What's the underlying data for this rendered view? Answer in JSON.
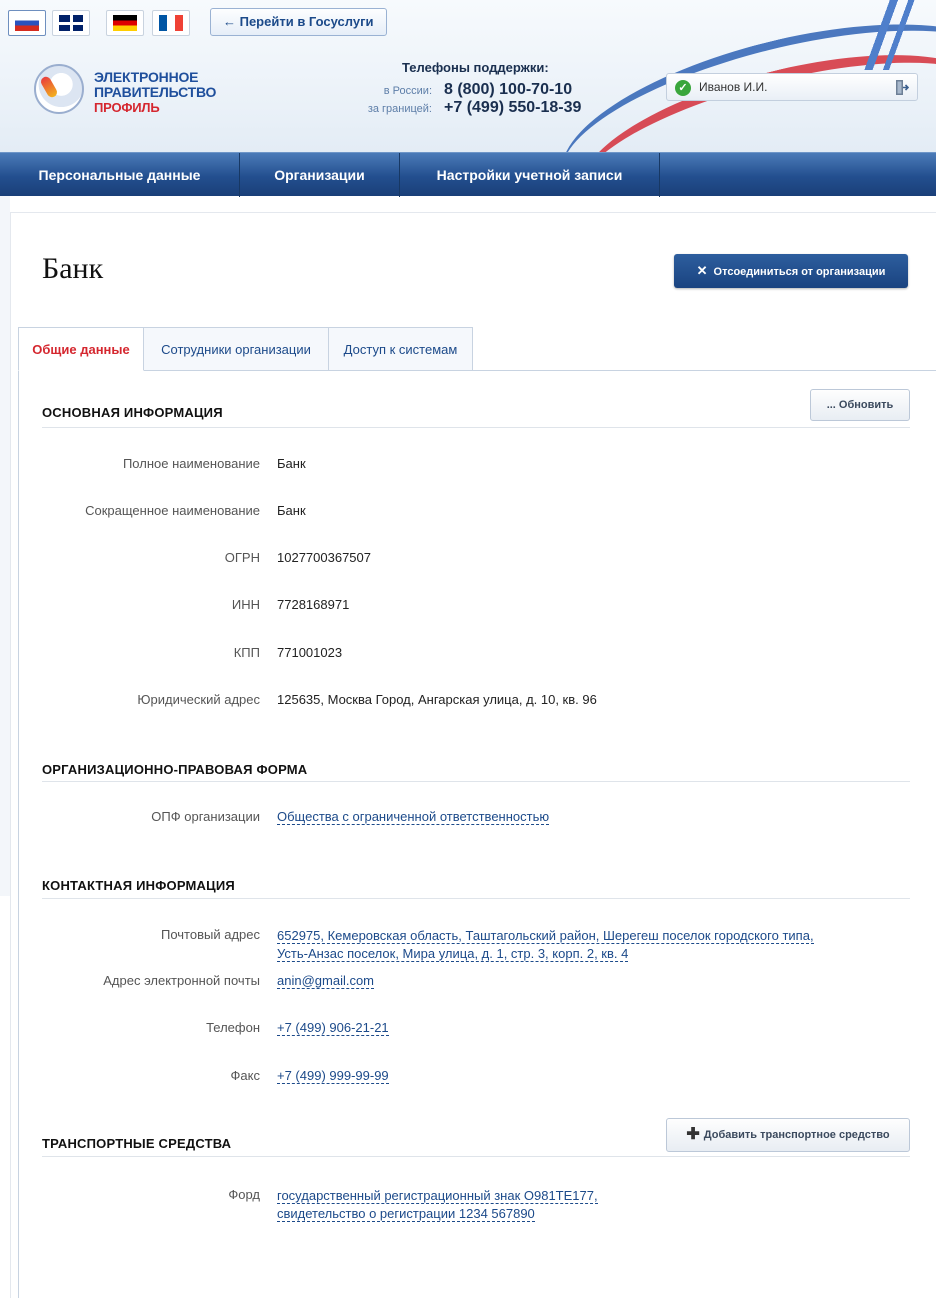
{
  "header": {
    "languages": [
      "ru",
      "en",
      "de",
      "fr"
    ],
    "gosuslugi_link": "← Перейти в Госуслуги",
    "logo": {
      "line1": "ЭЛЕКТРОННОЕ",
      "line2": "ПРАВИТЕЛЬСТВО",
      "line3": "ПРОФИЛЬ"
    },
    "support": {
      "title": "Телефоны поддержки:",
      "russia_label": "в России:",
      "russia_number": "8 (800) 100-70-10",
      "abroad_label": "за границей:",
      "abroad_number": "+7 (499) 550-18-39"
    },
    "user": {
      "name": "Иванов И.И."
    }
  },
  "nav": {
    "items": [
      {
        "label": "Персональные данные"
      },
      {
        "label": "Организации"
      },
      {
        "label": "Настройки учетной записи"
      }
    ]
  },
  "page": {
    "title": "Банк",
    "disconnect_label": "Отсоединиться от организации",
    "tabs": [
      {
        "label": "Общие данные",
        "active": true
      },
      {
        "label": "Сотрудники организации",
        "active": false
      },
      {
        "label": "Доступ к системам",
        "active": false
      }
    ]
  },
  "basic": {
    "heading": "ОСНОВНАЯ ИНФОРМАЦИЯ",
    "refresh_label": "... Обновить",
    "rows": [
      {
        "label": "Полное наименование",
        "value": "Банк"
      },
      {
        "label": "Сокращенное наименование",
        "value": "Банк"
      },
      {
        "label": "ОГРН",
        "value": "1027700367507"
      },
      {
        "label": "ИНН",
        "value": "7728168971"
      },
      {
        "label": "КПП",
        "value": "771001023"
      },
      {
        "label": "Юридический адрес",
        "value": "125635, Москва Город, Ангарская улица, д. 10, кв. 96"
      }
    ]
  },
  "legal_form": {
    "heading": "ОРГАНИЗАЦИОННО-ПРАВОВАЯ ФОРМА",
    "label": "ОПФ организации",
    "value": "Общества с ограниченной ответственностью"
  },
  "contacts": {
    "heading": "КОНТАКТНАЯ ИНФОРМАЦИЯ",
    "postal_label": "Почтовый адрес",
    "postal_line1": "652975, Кемеровская область, Таштагольский район, Шерегеш поселок городского типа,",
    "postal_line2": "Усть-Анзас поселок, Мира улица, д. 1, стр. 3, корп. 2, кв. 4",
    "email_label": "Адрес электронной почты",
    "email_value": "anin@gmail.com",
    "phone_label": "Телефон",
    "phone_value": "+7 (499) 906-21-21",
    "fax_label": "Факс",
    "fax_value": "+7 (499) 999-99-99"
  },
  "vehicles": {
    "heading": "ТРАНСПОРТНЫЕ СРЕДСТВА",
    "add_label": "Добавить транспортное средство",
    "items": [
      {
        "label": "Форд",
        "line1": "государственный регистрационный знак О981ТЕ177,",
        "line2": "свидетельство о регистрации 1234 567890"
      }
    ]
  },
  "colors": {
    "accent": "#1c4a8a",
    "active_tab": "#d5272f",
    "nav": "#234f8f"
  }
}
